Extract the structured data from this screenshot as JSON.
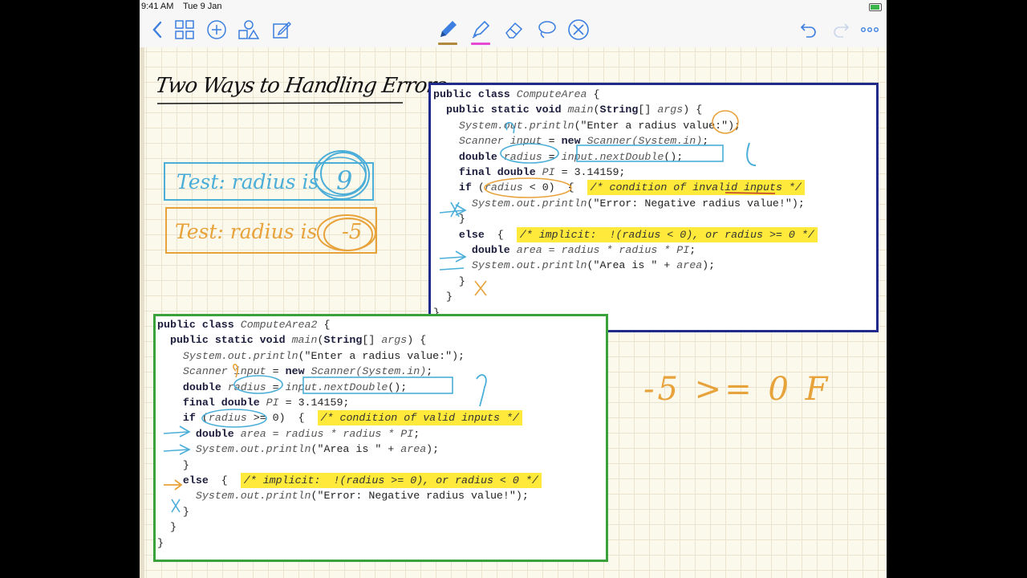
{
  "status_bar": {
    "time": "9:41 AM",
    "date": "Tue 9 Jan"
  },
  "toolbar": {
    "icons": [
      "back-icon",
      "grid-icon",
      "add-icon",
      "shapes-icon",
      "edit-icon",
      "pen-icon",
      "highlighter-icon",
      "eraser-icon",
      "lasso-icon",
      "close-icon",
      "undo-icon",
      "redo-icon",
      "more-icon"
    ],
    "pen_color": "#b08a3a",
    "highlighter_color": "#e44bd0",
    "accent": "#3c7fe0"
  },
  "note": {
    "title": "Two Ways to Handling Errors",
    "test1": {
      "label": "Test: radius is",
      "value": "9",
      "color": "#4aaed8"
    },
    "test2": {
      "label": "Test: radius is",
      "value": "-5",
      "color": "#e8a23a"
    },
    "side_note": "-5 >= 0  F"
  },
  "code1": {
    "border_color": "#1f2a8a",
    "lines": [
      {
        "parts": [
          {
            "t": "public class ",
            "c": "kw"
          },
          {
            "t": "ComputeArea",
            "c": "it"
          },
          {
            "t": " {"
          }
        ]
      },
      {
        "parts": [
          {
            "t": "  "
          },
          {
            "t": "public static void ",
            "c": "kw"
          },
          {
            "t": "main",
            "c": "it"
          },
          {
            "t": "("
          },
          {
            "t": "String",
            "c": "kw"
          },
          {
            "t": "[] "
          },
          {
            "t": "args",
            "c": "it"
          },
          {
            "t": ") {"
          }
        ]
      },
      {
        "parts": [
          {
            "t": "    "
          },
          {
            "t": "System.out.println",
            "c": "it"
          },
          {
            "t": "(\"Enter a radius value:\");"
          }
        ]
      },
      {
        "parts": [
          {
            "t": "    "
          },
          {
            "t": "Scanner input",
            "c": "it"
          },
          {
            "t": " = "
          },
          {
            "t": "new",
            "c": "kw"
          },
          {
            "t": " "
          },
          {
            "t": "Scanner(System.in)",
            "c": "it"
          },
          {
            "t": ";"
          }
        ]
      },
      {
        "parts": [
          {
            "t": "    "
          },
          {
            "t": "double",
            "c": "kw"
          },
          {
            "t": " "
          },
          {
            "t": "radius",
            "c": "it"
          },
          {
            "t": " = "
          },
          {
            "t": "input.nextDouble",
            "c": "it"
          },
          {
            "t": "();"
          }
        ]
      },
      {
        "parts": [
          {
            "t": "    "
          },
          {
            "t": "final double",
            "c": "kw"
          },
          {
            "t": " "
          },
          {
            "t": "PI",
            "c": "it"
          },
          {
            "t": " = 3.14159;"
          }
        ]
      },
      {
        "parts": [
          {
            "t": "    "
          },
          {
            "t": "if",
            "c": "kw"
          },
          {
            "t": " ("
          },
          {
            "t": "radius",
            "c": "it"
          },
          {
            "t": " < 0)  {  "
          },
          {
            "t": "/* condition of invalid inputs */",
            "c": "hl"
          }
        ]
      },
      {
        "parts": [
          {
            "t": "      "
          },
          {
            "t": "System.out.println",
            "c": "it"
          },
          {
            "t": "(\"Error: Negative radius value!\");"
          }
        ]
      },
      {
        "parts": [
          {
            "t": "    }"
          }
        ]
      },
      {
        "parts": [
          {
            "t": "    "
          },
          {
            "t": "else",
            "c": "kw"
          },
          {
            "t": "  {  "
          },
          {
            "t": "/* implicit:  !(radius < 0), or radius >= 0 */",
            "c": "hl"
          }
        ]
      },
      {
        "parts": [
          {
            "t": "      "
          },
          {
            "t": "double",
            "c": "kw"
          },
          {
            "t": " "
          },
          {
            "t": "area = radius * radius * PI",
            "c": "it"
          },
          {
            "t": ";"
          }
        ]
      },
      {
        "parts": [
          {
            "t": "      "
          },
          {
            "t": "System.out.println",
            "c": "it"
          },
          {
            "t": "(\"Area is \" + "
          },
          {
            "t": "area",
            "c": "it"
          },
          {
            "t": ");"
          }
        ]
      },
      {
        "parts": [
          {
            "t": "    }"
          }
        ]
      },
      {
        "parts": [
          {
            "t": "  }"
          }
        ]
      },
      {
        "parts": [
          {
            "t": "}"
          }
        ]
      }
    ]
  },
  "code2": {
    "border_color": "#3aa23a",
    "lines": [
      {
        "parts": [
          {
            "t": "public class ",
            "c": "kw"
          },
          {
            "t": "ComputeArea2",
            "c": "it"
          },
          {
            "t": " {"
          }
        ]
      },
      {
        "parts": [
          {
            "t": "  "
          },
          {
            "t": "public static void ",
            "c": "kw"
          },
          {
            "t": "main",
            "c": "it"
          },
          {
            "t": "("
          },
          {
            "t": "String",
            "c": "kw"
          },
          {
            "t": "[] "
          },
          {
            "t": "args",
            "c": "it"
          },
          {
            "t": ") {"
          }
        ]
      },
      {
        "parts": [
          {
            "t": "    "
          },
          {
            "t": "System.out.println",
            "c": "it"
          },
          {
            "t": "(\"Enter a radius value:\");"
          }
        ]
      },
      {
        "parts": [
          {
            "t": "    "
          },
          {
            "t": "Scanner input",
            "c": "it"
          },
          {
            "t": " = "
          },
          {
            "t": "new",
            "c": "kw"
          },
          {
            "t": " "
          },
          {
            "t": "Scanner(System.in)",
            "c": "it"
          },
          {
            "t": ";"
          }
        ]
      },
      {
        "parts": [
          {
            "t": "    "
          },
          {
            "t": "double",
            "c": "kw"
          },
          {
            "t": " "
          },
          {
            "t": "radius",
            "c": "it"
          },
          {
            "t": " = "
          },
          {
            "t": "input.nextDouble",
            "c": "it"
          },
          {
            "t": "();"
          }
        ]
      },
      {
        "parts": [
          {
            "t": "    "
          },
          {
            "t": "final double",
            "c": "kw"
          },
          {
            "t": " "
          },
          {
            "t": "PI",
            "c": "it"
          },
          {
            "t": " = 3.14159;"
          }
        ]
      },
      {
        "parts": [
          {
            "t": "    "
          },
          {
            "t": "if",
            "c": "kw"
          },
          {
            "t": " ("
          },
          {
            "t": "radius",
            "c": "it"
          },
          {
            "t": " >= 0)  {  "
          },
          {
            "t": "/* condition of valid inputs */",
            "c": "hl"
          }
        ]
      },
      {
        "parts": [
          {
            "t": "      "
          },
          {
            "t": "double",
            "c": "kw"
          },
          {
            "t": " "
          },
          {
            "t": "area = radius * radius * PI",
            "c": "it"
          },
          {
            "t": ";"
          }
        ]
      },
      {
        "parts": [
          {
            "t": "      "
          },
          {
            "t": "System.out.println",
            "c": "it"
          },
          {
            "t": "(\"Area is \" + "
          },
          {
            "t": "area",
            "c": "it"
          },
          {
            "t": ");"
          }
        ]
      },
      {
        "parts": [
          {
            "t": "    }"
          }
        ]
      },
      {
        "parts": [
          {
            "t": "    "
          },
          {
            "t": "else",
            "c": "kw"
          },
          {
            "t": "  {  "
          },
          {
            "t": "/* implicit:  !(radius >= 0), or radius < 0 */",
            "c": "hl"
          }
        ]
      },
      {
        "parts": [
          {
            "t": "      "
          },
          {
            "t": "System.out.println",
            "c": "it"
          },
          {
            "t": "(\"Error: Negative radius value!\");"
          }
        ]
      },
      {
        "parts": [
          {
            "t": "    }"
          }
        ]
      },
      {
        "parts": [
          {
            "t": "  }"
          }
        ]
      },
      {
        "parts": [
          {
            "t": "}"
          }
        ]
      }
    ]
  }
}
